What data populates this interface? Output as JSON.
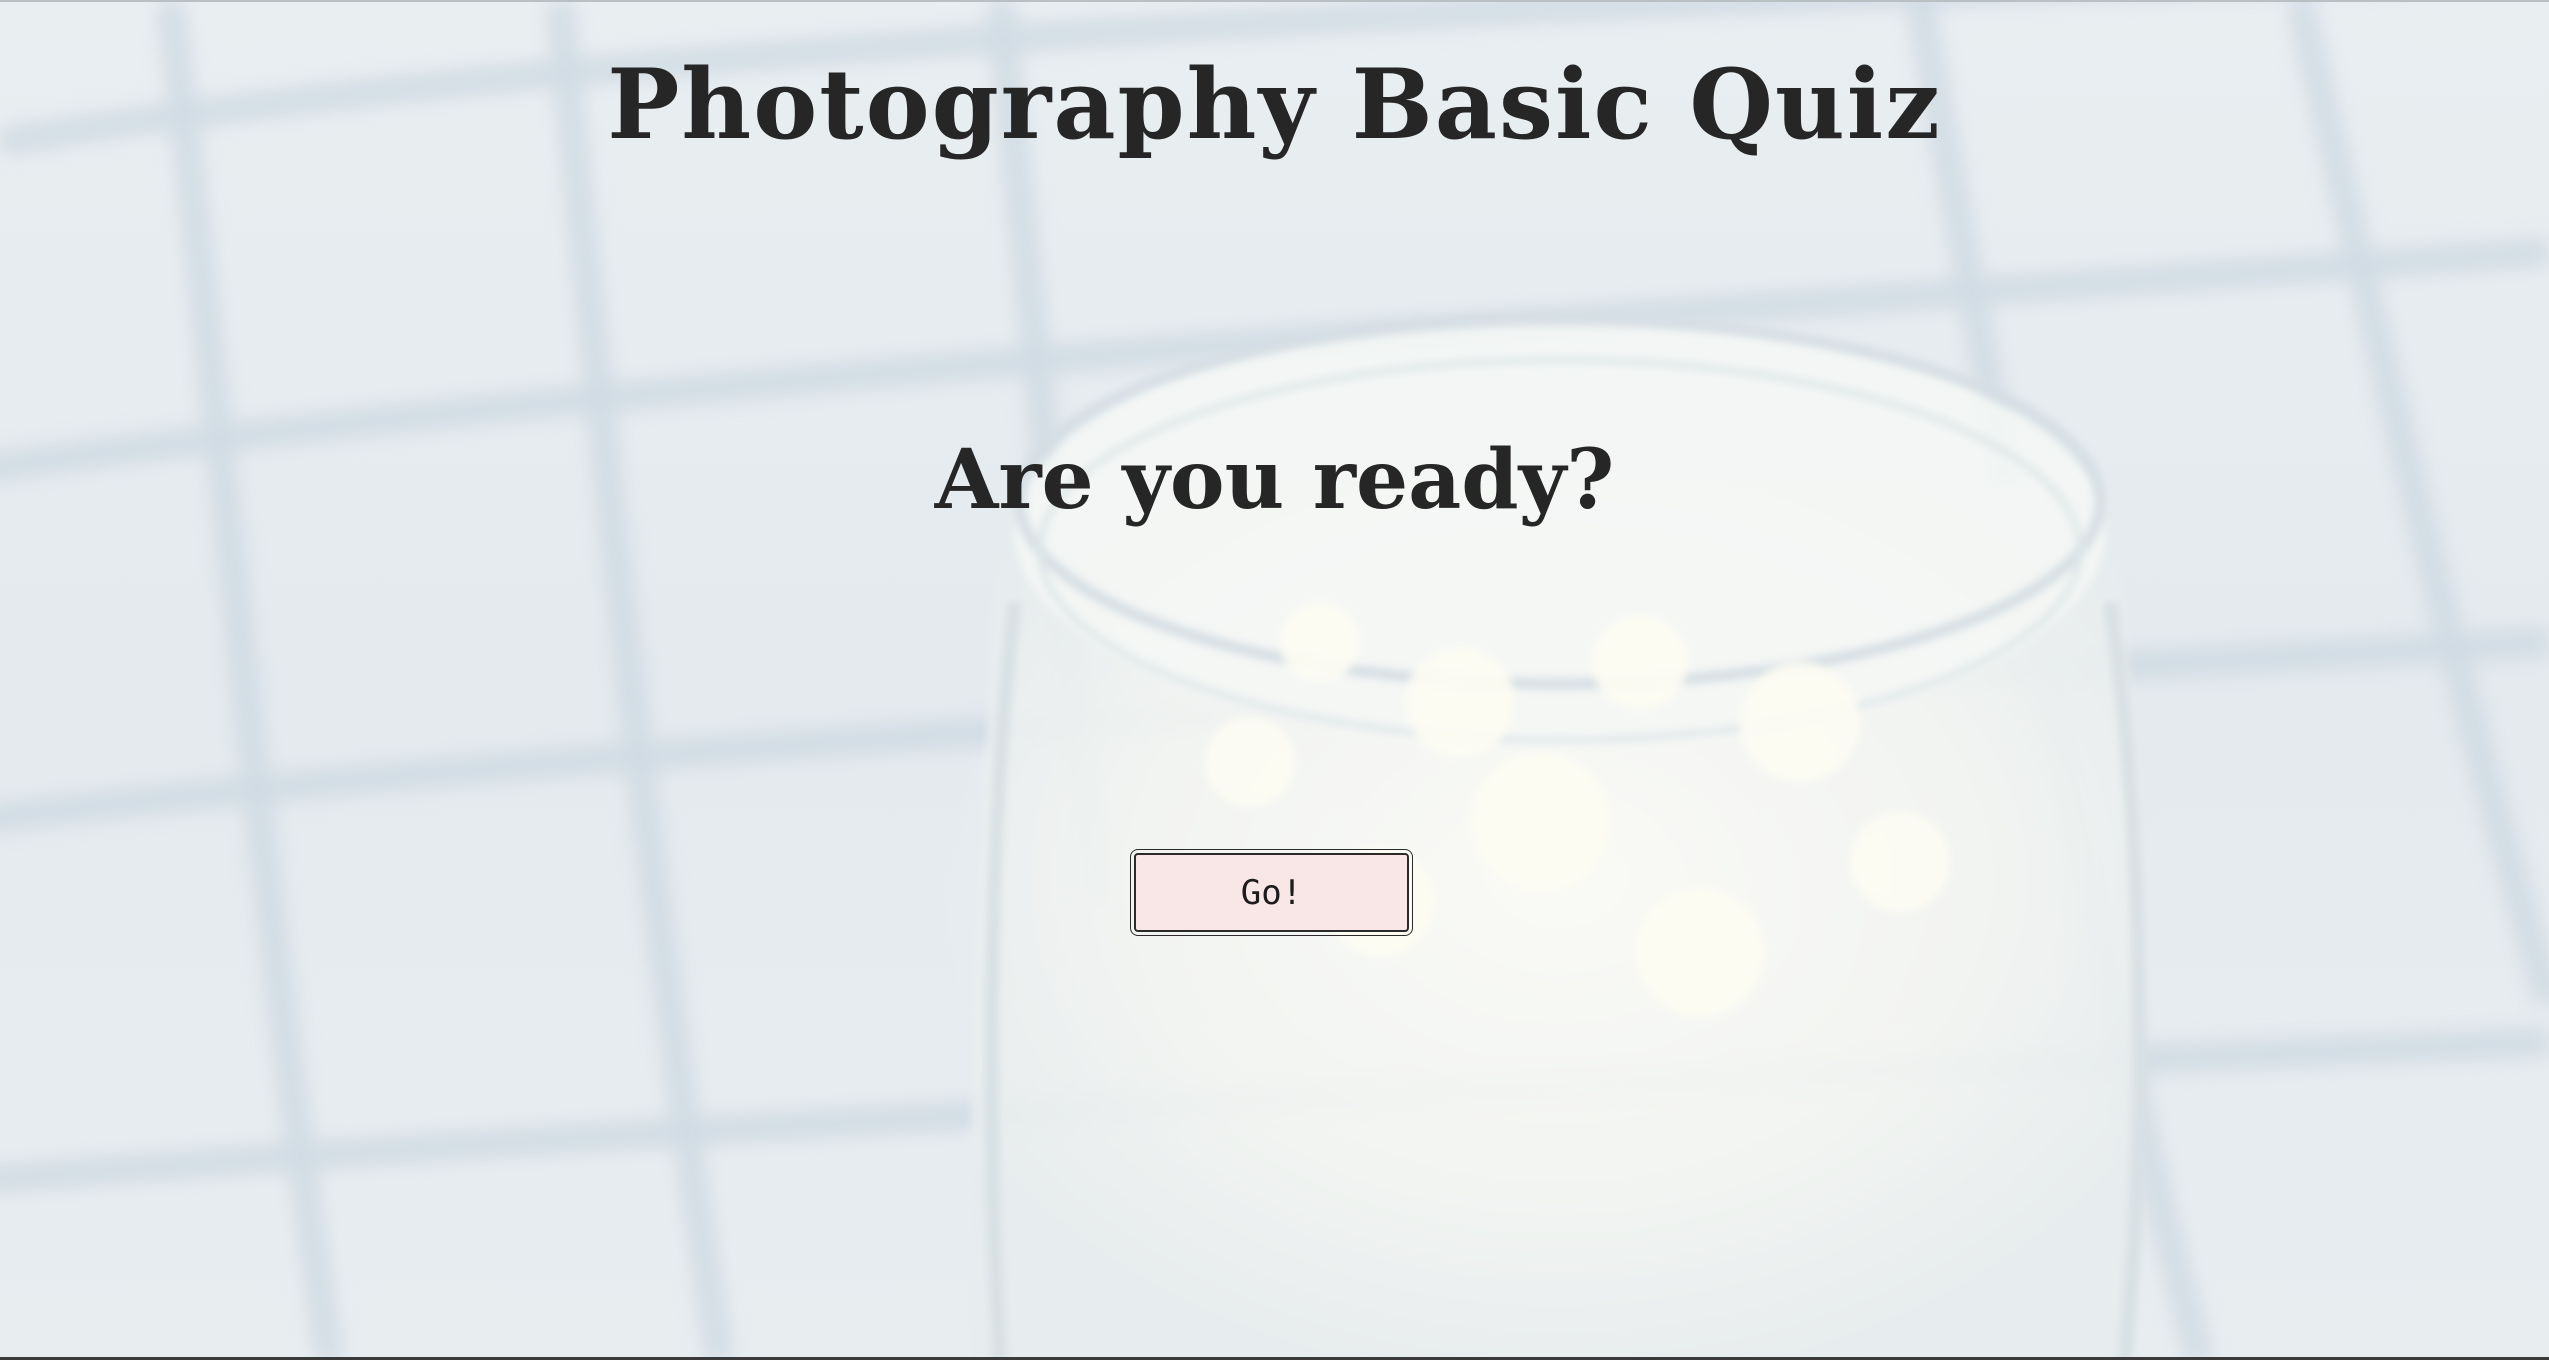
{
  "page": {
    "title": "Photography Basic Quiz",
    "prompt": "Are you ready?",
    "start_button_label": "Go!"
  },
  "colors": {
    "background": "#e6ebee",
    "text": "#262626",
    "button_fill": "#f9e7e8",
    "button_border": "#2b2b2b"
  },
  "background_image": "blurred glass jar of milk on a white tiled surface"
}
